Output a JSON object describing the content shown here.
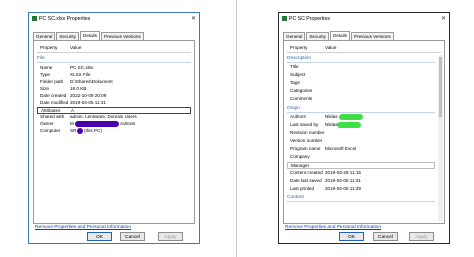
{
  "colors": {
    "highlight_left": "#4b00a8",
    "highlight_right": "#3fe046",
    "section": "#3366aa",
    "link": "#0645ad"
  },
  "left": {
    "title": "PC SC.xlsx Properties",
    "tabs": [
      "General",
      "Security",
      "Details",
      "Previous Versions"
    ],
    "header": {
      "property": "Property",
      "value": "Value"
    },
    "section": "File",
    "rows": [
      {
        "k": "Name",
        "v": "PC SC.xlsx"
      },
      {
        "k": "Type",
        "v": "XLSX File"
      },
      {
        "k": "Folder path",
        "v": "D:\\Shares\\Dokument"
      },
      {
        "k": "Size",
        "v": "18.0 KB"
      },
      {
        "k": "Date created",
        "v": "2022-10-09 20:09"
      },
      {
        "k": "Date modified",
        "v": "2019-04-05 11:31"
      },
      {
        "k": "Attributes",
        "v": "A"
      },
      {
        "k": "Shared with",
        "v": "admin, Lensware, Domain Users"
      },
      {
        "k": "Owner",
        "v": "M",
        "suffix": "Admins"
      },
      {
        "k": "Computer",
        "v": "SR",
        "suffix": "(this PC)"
      }
    ],
    "link": "Remove Properties and Personal Information",
    "buttons": {
      "ok": "OK",
      "cancel": "Cancel",
      "apply": "Apply"
    }
  },
  "right": {
    "title": "PC SC Properties",
    "tabs": [
      "General",
      "Security",
      "Details",
      "Previous Versions"
    ],
    "header": {
      "property": "Property",
      "value": "Value"
    },
    "sections": {
      "description": "Description",
      "origin": "Origin",
      "content": "Content"
    },
    "desc_rows": [
      "Title",
      "Subject",
      "Tags",
      "Categories",
      "Comments"
    ],
    "origin_rows": [
      {
        "k": "Authors",
        "v": "Niklas"
      },
      {
        "k": "Last saved by",
        "v": "Niklas"
      },
      {
        "k": "Revision number",
        "v": ""
      },
      {
        "k": "Version number",
        "v": ""
      },
      {
        "k": "Program name",
        "v": "Microsoft Excel"
      },
      {
        "k": "Company",
        "v": ""
      },
      {
        "k": "Manager",
        "v": ""
      },
      {
        "k": "Content created",
        "v": "2019-03-28 11:15"
      },
      {
        "k": "Date last saved",
        "v": "2019-04-05 11:31"
      },
      {
        "k": "Last printed",
        "v": "2019-04-05 11:29"
      }
    ],
    "link": "Remove Properties and Personal Information",
    "buttons": {
      "ok": "OK",
      "cancel": "Cancel",
      "apply": "Apply"
    }
  }
}
